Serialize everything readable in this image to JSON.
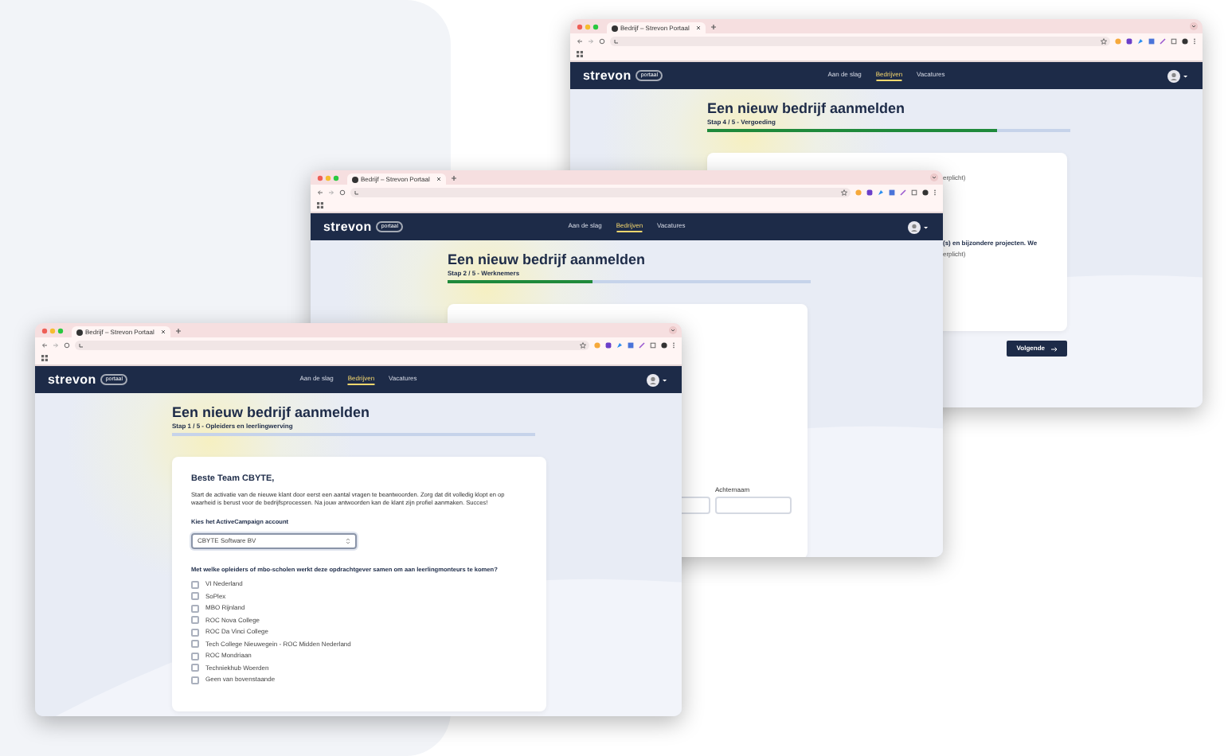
{
  "windows": [
    {
      "tab_title": "Bedrijf – Strevon Portaal",
      "logo": "strevon",
      "logo_badge": "portaal",
      "nav": [
        {
          "label": "Aan de slag",
          "selected": false
        },
        {
          "label": "Bedrijven",
          "selected": true
        },
        {
          "label": "Vacatures",
          "selected": false
        }
      ],
      "heading": "Een nieuw bedrijf aanmelden",
      "step": "Stap 4 / 5 - Vergoeding",
      "level": 0.8,
      "card": {
        "kind": "fragments",
        "lines": [
          "erplicht)",
          "(s) en bijzondere projecten. We",
          "erplicht)"
        ]
      },
      "next_button": "Volgende"
    },
    {
      "tab_title": "Bedrijf – Strevon Portaal",
      "logo": "strevon",
      "logo_badge": "portaal",
      "nav": [
        {
          "label": "Aan de slag",
          "selected": false
        },
        {
          "label": "Bedrijven",
          "selected": true
        },
        {
          "label": "Vacatures",
          "selected": false
        }
      ],
      "heading": "Een nieuw bedrijf aanmelden",
      "step": "Stap 2 / 5 - Werknemers",
      "level": 0.4,
      "card": {
        "kind": "names",
        "field_label": "Achternaam"
      }
    },
    {
      "tab_title": "Bedrijf – Strevon Portaal",
      "logo": "strevon",
      "logo_badge": "portaal",
      "nav": [
        {
          "label": "Aan de slag",
          "selected": false
        },
        {
          "label": "Bedrijven",
          "selected": true
        },
        {
          "label": "Vacatures",
          "selected": false
        }
      ],
      "heading": "Een nieuw bedrijf aanmelden",
      "step": "Stap 1 / 5 - Opleiders en leerlingwerving",
      "level": 0,
      "card": {
        "kind": "intro",
        "greeting": "Beste Team CBYTE,",
        "intro": "Start de activatie van de nieuwe klant door eerst een aantal vragen te beantwoorden. Zorg dat dit volledig klopt en op waarheid is berust voor de bedrijfsprocessen. Na jouw antwoorden kan de klant zijn profiel aanmaken. Succes!",
        "account_label": "Kies het ActiveCampaign account",
        "account_value": "CBYTE Software BV",
        "question": "Met welke opleiders of mbo-scholen werkt deze opdrachtgever samen om aan leerlingmonteurs te komen?",
        "options": [
          {
            "label": "VI Nederland",
            "checked": false
          },
          {
            "label": "SoPlex",
            "checked": false
          },
          {
            "label": "MBO Rijnland",
            "checked": false
          },
          {
            "label": "ROC Nova College",
            "checked": false
          },
          {
            "label": "ROC Da Vinci College",
            "checked": false
          },
          {
            "label": "Tech College Nieuwegein - ROC Midden Nederland",
            "checked": false
          },
          {
            "label": "ROC Mondriaan",
            "checked": false
          },
          {
            "label": "Techniekhub Woerden",
            "checked": false
          },
          {
            "label": "Geen van bovenstaande",
            "checked": false
          }
        ]
      }
    }
  ]
}
